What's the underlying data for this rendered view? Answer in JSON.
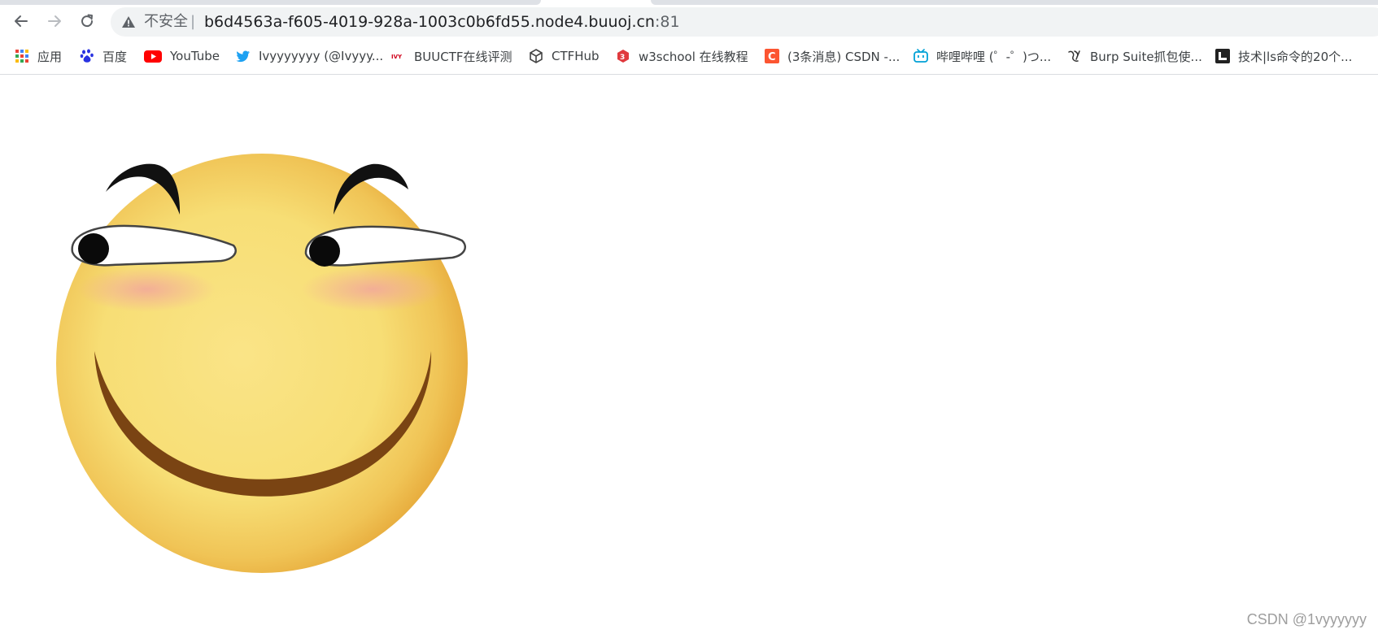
{
  "browser": {
    "security_label": "不安全",
    "separator": "|",
    "url_host": "b6d4563a-f605-4019-928a-1003c0b6fd55.node4.buuoj.cn",
    "url_port": ":81"
  },
  "bookmarks": [
    {
      "label": "应用",
      "icon": "apps-grid-icon"
    },
    {
      "label": "百度",
      "icon": "baidu-paw-icon"
    },
    {
      "label": "YouTube",
      "icon": "youtube-icon"
    },
    {
      "label": "Ivyyyyyyy (@Ivyyy...",
      "icon": "twitter-icon"
    },
    {
      "label": "BUUCTF在线评测",
      "icon": "buuctf-icon"
    },
    {
      "label": "CTFHub",
      "icon": "ctfhub-cube-icon"
    },
    {
      "label": "w3school 在线教程",
      "icon": "w3school-icon"
    },
    {
      "label": "(3条消息) CSDN -...",
      "icon": "csdn-icon"
    },
    {
      "label": "哔哩哔哩 (゜-゜)つ...",
      "icon": "bilibili-icon"
    },
    {
      "label": "Burp Suite抓包使...",
      "icon": "burp-icon"
    },
    {
      "label": "技术|ls命令的20个...",
      "icon": "page-tile-icon"
    }
  ],
  "page": {
    "image": "smirking-emoji-face",
    "watermark": "CSDN @1vyyyyyy"
  },
  "colors": {
    "face_yellow": "#f8df78",
    "face_edge": "#eaae3e",
    "mouth": "#7a4413",
    "blush": "#f3b8a0"
  }
}
